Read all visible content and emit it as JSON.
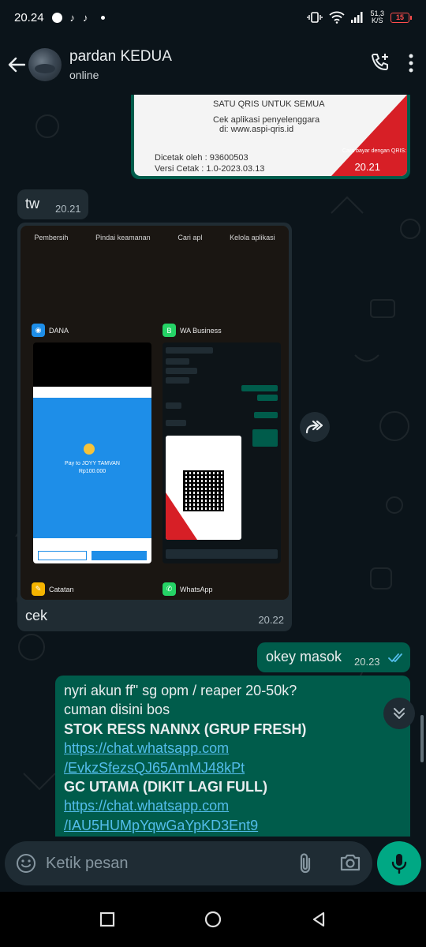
{
  "status_bar": {
    "time": "20.24",
    "network_speed_top": "51,3",
    "network_speed_unit": "K/S",
    "battery": "15"
  },
  "header": {
    "contact_name": "pardan KEDUA",
    "contact_status": "online"
  },
  "messages": {
    "qris_image": {
      "line1": "SATU QRIS UNTUK SEMUA",
      "line2": "Cek aplikasi penyelenggara",
      "line3": "di: www.aspi-qris.id",
      "printed_by": "Dicetak oleh : 93600503",
      "version": "Versi Cetak  : 1.0-2023.03.13",
      "pay_hint": "Cara bayar dengan QRIS:",
      "time": "20.21"
    },
    "tw": {
      "text": "tw",
      "time": "20.21"
    },
    "screenshot": {
      "top_menu": [
        "Pembersih",
        "Pindai keamanan",
        "Cari apl",
        "Kelola aplikasi"
      ],
      "app1_name": "DANA",
      "app2_name": "WA Business",
      "app3_name": "Catatan",
      "app4_name": "WhatsApp",
      "dana_pay_to": "Pay to JOYY TAMVAN",
      "dana_amount": "Rp100.000",
      "caption": "cek",
      "time": "20.22"
    },
    "okey": {
      "text": "okey masok",
      "time": "20.23"
    },
    "long": {
      "line1": "nyri akun ff\" sg opm / reaper 20-50k?",
      "line2": "cuman disini bos",
      "line3": "STOK RESS NANNX (GRUP FRESH)",
      "line4": "https://chat.whatsapp.com",
      "line5": "/EvkzSfezsQJ65AmMJ48kPt",
      "line6": "GC UTAMA (DIKIT LAGI FULL)",
      "line7": "https://chat.whatsapp.com",
      "line8": "/IAU5HUMpYqwGaYpKD3Ent9"
    }
  },
  "input": {
    "placeholder": "Ketik pesan"
  },
  "colors": {
    "background": "#0b141a",
    "incoming": "#202c33",
    "outgoing": "#005c4b",
    "accent": "#00a884",
    "link": "#53bdeb"
  }
}
